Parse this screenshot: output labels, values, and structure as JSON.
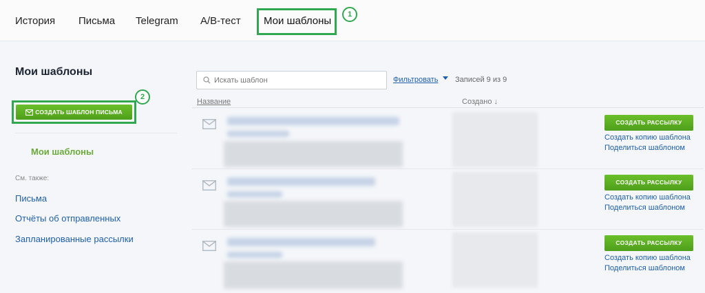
{
  "nav": {
    "tabs": [
      "История",
      "Письма",
      "Telegram",
      "A/B-тест"
    ],
    "active_tab": "Мои шаблоны",
    "badge_1": "1"
  },
  "sidebar": {
    "title": "Мои шаблоны",
    "create_button": "СОЗДАТЬ ШАБЛОН ПИСЬМА",
    "badge_2": "2",
    "active_item": "Мои шаблоны",
    "see_also_label": "См. также:",
    "links": [
      "Письма",
      "Отчёты об отправленных",
      "Запланированные рассылки"
    ]
  },
  "toolbar": {
    "search_placeholder": "Искать шаблон",
    "filter_label": "Фильтровать",
    "records_label": "Записей 9 из 9"
  },
  "table": {
    "col_name": "Название",
    "col_created": "Создано ↓",
    "rows": [
      {
        "send_label": "СОЗДАТЬ РАССЫЛКУ",
        "copy_label": "Создать копию шаблона",
        "share_label": "Поделиться шаблоном"
      },
      {
        "send_label": "СОЗДАТЬ РАССЫЛКУ",
        "copy_label": "Создать копию шаблона",
        "share_label": "Поделиться шаблоном"
      },
      {
        "send_label": "СОЗДАТЬ РАССЫЛКУ",
        "copy_label": "Создать копию шаблона",
        "share_label": "Поделиться шаблоном"
      }
    ]
  },
  "colors": {
    "accent_green": "#2fa84f",
    "button_green": "#5aaf22",
    "link_blue": "#1f5fa8"
  }
}
